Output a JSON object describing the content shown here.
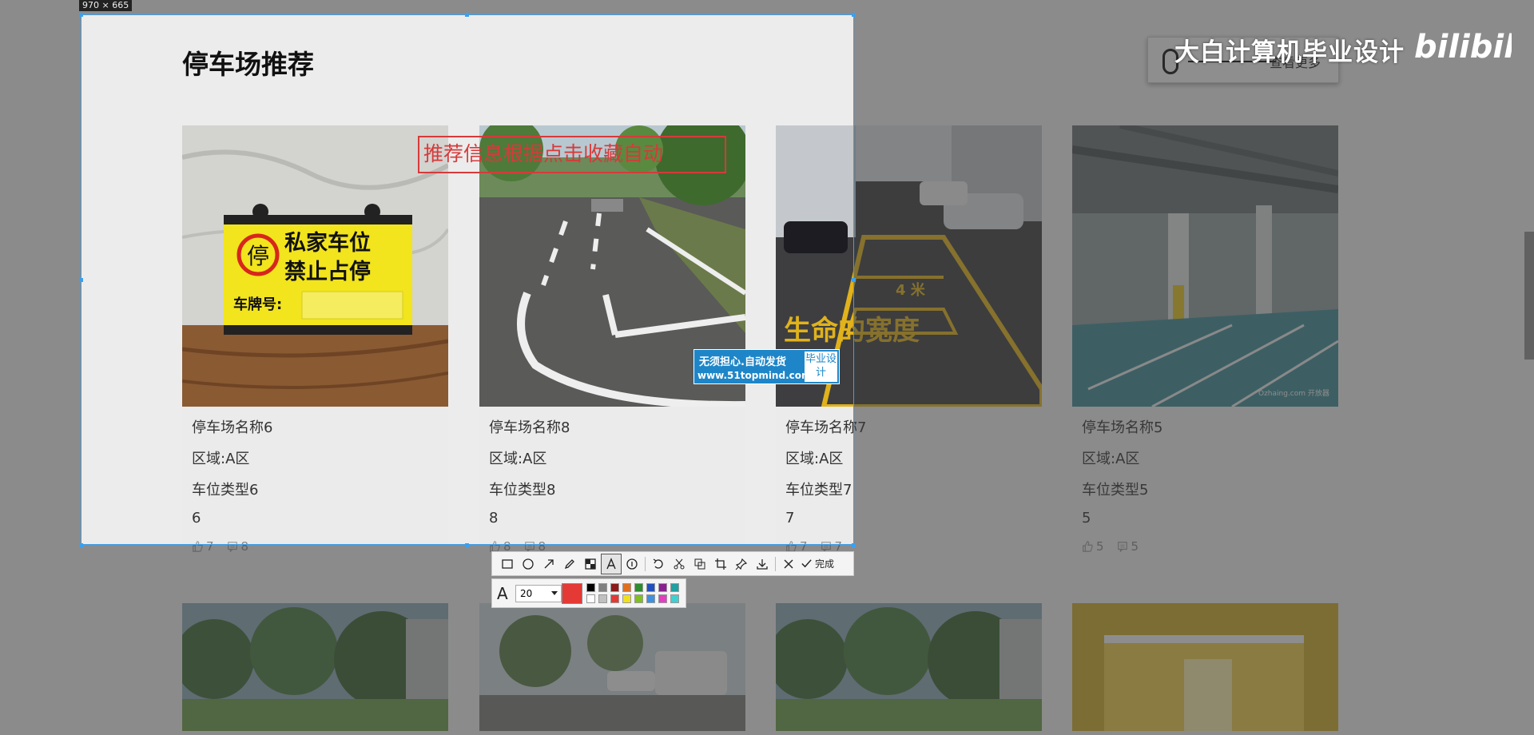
{
  "section": {
    "title": "停车场推荐",
    "more_label": "查看更多"
  },
  "cards": [
    {
      "name": "停车场名称6",
      "area": "区域:A区",
      "type": "车位类型6",
      "price": "6",
      "likes": "7",
      "comments": "8",
      "sign": {
        "line1": "私家车位",
        "line2": "禁止占停",
        "plate_label": "车牌号:",
        "stop": "停"
      }
    },
    {
      "name": "停车场名称8",
      "area": "区域:A区",
      "type": "车位类型8",
      "price": "8",
      "likes": "8",
      "comments": "8"
    },
    {
      "name": "停车场名称7",
      "area": "区域:A区",
      "type": "车位类型7",
      "price": "7",
      "likes": "7",
      "comments": "7",
      "road_text": "生命的宽度",
      "road_dist": "4 米"
    },
    {
      "name": "停车场名称5",
      "area": "区域:A区",
      "type": "车位类型5",
      "price": "5",
      "likes": "5",
      "comments": "5",
      "credit": "Ozhaing.com 开放器"
    }
  ],
  "screenshot_tool": {
    "dimension_label": "970 × 665",
    "annotation_text": "推荐信息根据点击收藏自动",
    "done_label": "完成",
    "font_size": "20",
    "current_color": "#e53935",
    "palette": [
      "#000000",
      "#808080",
      "#8b1a1a",
      "#e07020",
      "#2e8b2e",
      "#2050c0",
      "#8a2090",
      "#20a0a0",
      "#ffffff",
      "#c0c0c0",
      "#e53935",
      "#f0e020",
      "#80c020",
      "#4090e0",
      "#e040c0",
      "#40d0d0"
    ]
  },
  "watermark": {
    "title": "大白计算机毕业设计",
    "logo": "bilibili"
  },
  "ad": {
    "line1": "无须担心.自动发货",
    "line2": "www.51topmind.com",
    "box": "毕业设计"
  },
  "colors": {
    "accent": "#3aa0f0",
    "annotation": "#d63a3a"
  }
}
